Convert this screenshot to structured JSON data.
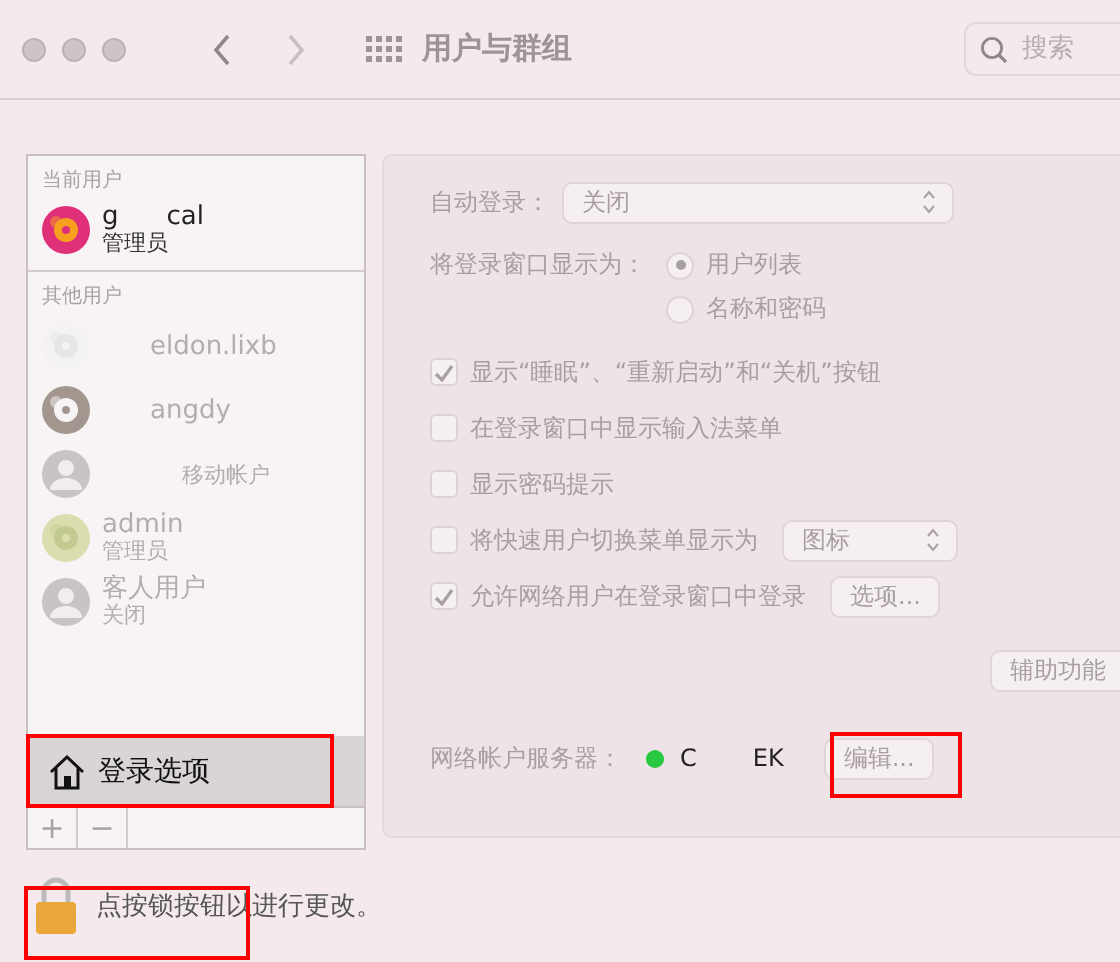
{
  "window": {
    "title": "用户与群组",
    "search": {
      "placeholder": "搜索"
    }
  },
  "sidebar": {
    "sections": [
      {
        "heading": "当前用户",
        "users": [
          {
            "name_parts": [
              "g",
              "cal"
            ],
            "role": "管理员",
            "disabled": false
          }
        ]
      },
      {
        "heading": "其他用户",
        "users": [
          {
            "name_parts": [
              "eldon.lixb"
            ],
            "disabled": true
          },
          {
            "name_parts": [
              "angdy"
            ],
            "disabled": true
          },
          {
            "role": "移动帐户",
            "kind": "silhouette",
            "disabled": true
          },
          {
            "name_parts": [
              "admin"
            ],
            "role": "管理员",
            "disabled": true
          },
          {
            "name_parts": [
              "客人用户"
            ],
            "role": "关闭",
            "kind": "silhouette",
            "disabled": true
          }
        ]
      }
    ],
    "login_options": {
      "label": "登录选项",
      "selected": true
    },
    "add": "+",
    "remove": "−"
  },
  "settings": {
    "auto_login": {
      "label": "自动登录：",
      "value": "关闭"
    },
    "show_login_as": {
      "label": "将登录窗口显示为：",
      "options": [
        {
          "label": "用户列表",
          "selected": true
        },
        {
          "label": "名称和密码",
          "selected": false
        }
      ]
    },
    "options": [
      {
        "kind": "checkbox",
        "label": "显示“睡眠”、“重新启动”和“关机”按钮",
        "checked": true
      },
      {
        "kind": "checkbox",
        "label": "在登录窗口中显示输入法菜单",
        "checked": false
      },
      {
        "kind": "checkbox",
        "label": "显示密码提示",
        "checked": false
      },
      {
        "kind": "select",
        "label": "将快速用户切换菜单显示为",
        "checked": false,
        "control": "图标"
      },
      {
        "kind": "button",
        "label": "允许网络用户在登录窗口中登录",
        "checked": true,
        "control": "选项..."
      }
    ],
    "accessibility": "辅助功能",
    "network_server": {
      "label": "网络帐户服务器：",
      "name_parts": [
        "C",
        "EK"
      ],
      "color": "#28c840",
      "button": "编辑..."
    }
  },
  "lock": {
    "text": "点按锁按钮以进行更改。",
    "locked": true
  }
}
